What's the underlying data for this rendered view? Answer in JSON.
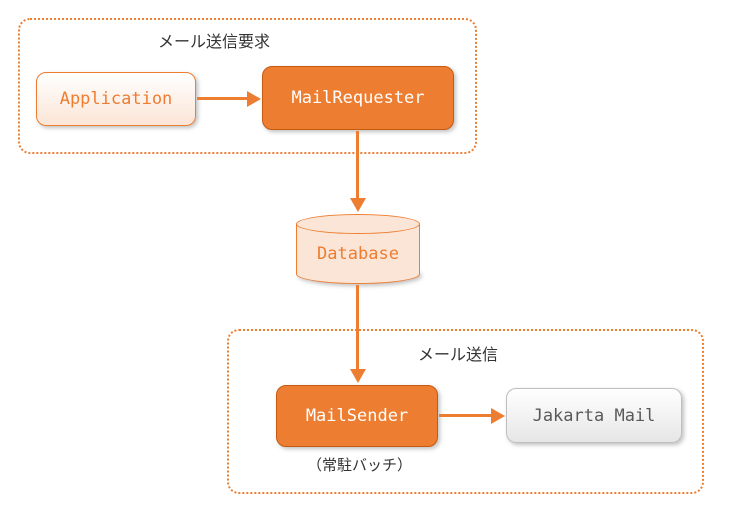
{
  "diagram": {
    "group_top_label": "メール送信要求",
    "group_bottom_label": "メール送信",
    "nodes": {
      "application": "Application",
      "mail_requester": "MailRequester",
      "database": "Database",
      "mail_sender": "MailSender",
      "jakarta_mail": "Jakarta Mail"
    },
    "mail_sender_note": "（常駐バッチ）",
    "colors": {
      "accent": "#ed7d31",
      "accent_dark": "#c55a11",
      "light_fill": "#fbe5d6",
      "grey_border": "#bfbfbf",
      "grey_text": "#595959"
    }
  }
}
